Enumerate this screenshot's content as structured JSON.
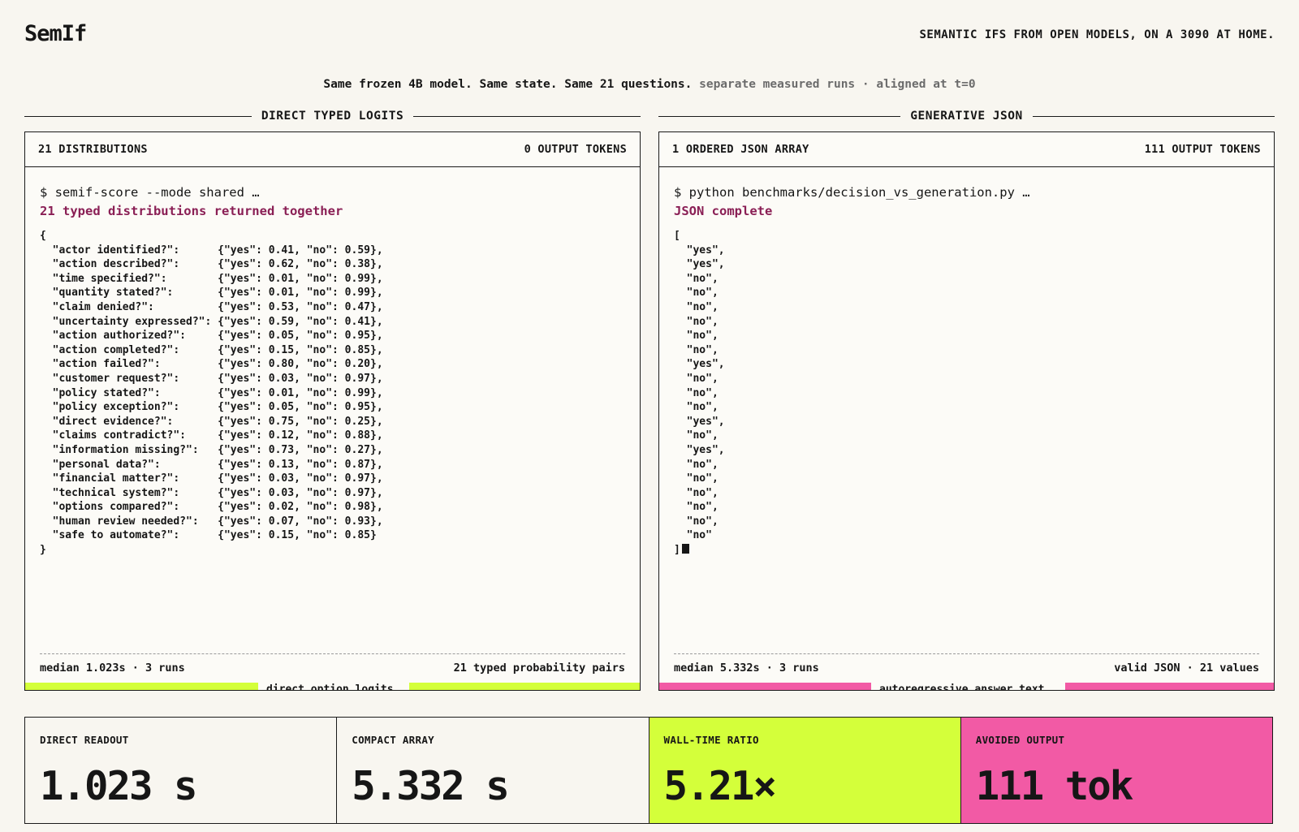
{
  "header": {
    "logo": "SemIf",
    "tagline": "SEMANTIC IFS FROM OPEN MODELS, ON A 3090 AT HOME."
  },
  "subtitle": {
    "strong": "Same frozen 4B model. Same state. Same 21 questions.",
    "muted": "separate measured runs · aligned at t=0"
  },
  "left": {
    "section_title": "DIRECT TYPED LOGITS",
    "header_left": "21 DISTRIBUTIONS",
    "header_right": "0 OUTPUT TOKENS",
    "command": "$ semif-score --mode shared …",
    "status": "21 typed distributions returned together",
    "code": "{\n  \"actor identified?\":      {\"yes\": 0.41, \"no\": 0.59},\n  \"action described?\":      {\"yes\": 0.62, \"no\": 0.38},\n  \"time specified?\":        {\"yes\": 0.01, \"no\": 0.99},\n  \"quantity stated?\":       {\"yes\": 0.01, \"no\": 0.99},\n  \"claim denied?\":          {\"yes\": 0.53, \"no\": 0.47},\n  \"uncertainty expressed?\": {\"yes\": 0.59, \"no\": 0.41},\n  \"action authorized?\":     {\"yes\": 0.05, \"no\": 0.95},\n  \"action completed?\":      {\"yes\": 0.15, \"no\": 0.85},\n  \"action failed?\":         {\"yes\": 0.80, \"no\": 0.20},\n  \"customer request?\":      {\"yes\": 0.03, \"no\": 0.97},\n  \"policy stated?\":         {\"yes\": 0.01, \"no\": 0.99},\n  \"policy exception?\":      {\"yes\": 0.05, \"no\": 0.95},\n  \"direct evidence?\":       {\"yes\": 0.75, \"no\": 0.25},\n  \"claims contradict?\":     {\"yes\": 0.12, \"no\": 0.88},\n  \"information missing?\":   {\"yes\": 0.73, \"no\": 0.27},\n  \"personal data?\":         {\"yes\": 0.13, \"no\": 0.87},\n  \"financial matter?\":      {\"yes\": 0.03, \"no\": 0.97},\n  \"technical system?\":      {\"yes\": 0.03, \"no\": 0.97},\n  \"options compared?\":      {\"yes\": 0.02, \"no\": 0.98},\n  \"human review needed?\":   {\"yes\": 0.07, \"no\": 0.93},\n  \"safe to automate?\":      {\"yes\": 0.15, \"no\": 0.85}\n}",
    "footer_left": "median 1.023s · 3 runs",
    "footer_right": "21 typed probability pairs",
    "bar_tag": "direct option logits"
  },
  "right": {
    "section_title": "GENERATIVE JSON",
    "header_left": "1 ORDERED JSON ARRAY",
    "header_right": "111 OUTPUT TOKENS",
    "command": "$ python benchmarks/decision_vs_generation.py …",
    "status": "JSON complete",
    "code": "[\n  \"yes\",\n  \"yes\",\n  \"no\",\n  \"no\",\n  \"no\",\n  \"no\",\n  \"no\",\n  \"no\",\n  \"yes\",\n  \"no\",\n  \"no\",\n  \"no\",\n  \"yes\",\n  \"no\",\n  \"yes\",\n  \"no\",\n  \"no\",\n  \"no\",\n  \"no\",\n  \"no\",\n  \"no\"\n]",
    "footer_left": "median 5.332s · 3 runs",
    "footer_right": "valid JSON · 21 values",
    "bar_tag": "autoregressive answer text"
  },
  "metrics": [
    {
      "label": "DIRECT READOUT",
      "value": "1.023 s"
    },
    {
      "label": "COMPACT ARRAY",
      "value": "5.332 s"
    },
    {
      "label": "WALL-TIME RATIO",
      "value": "5.21×"
    },
    {
      "label": "AVOIDED OUTPUT",
      "value": "111 tok"
    }
  ],
  "colors": {
    "accent_lime": "#d4ff3a",
    "accent_pink": "#f25aa5",
    "status_text": "#8a1f55",
    "background": "#f8f6f0"
  }
}
